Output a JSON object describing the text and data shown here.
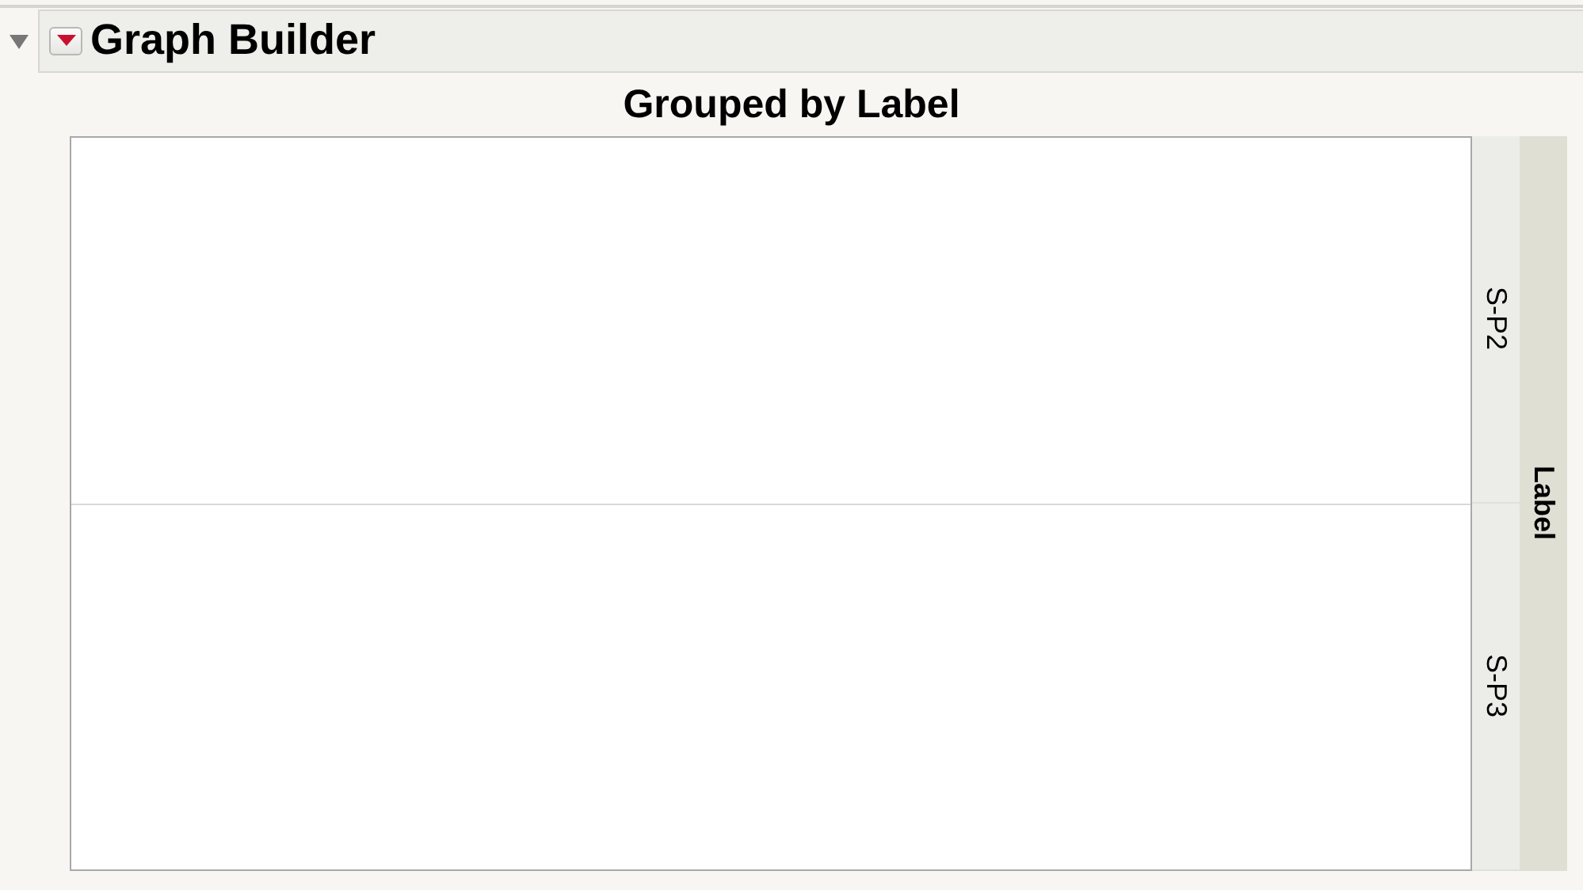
{
  "outline": {
    "expanded": true,
    "title": "Graph Builder"
  },
  "graph": {
    "title": "Grouped by Label",
    "group_title": "Label",
    "panels": [
      {
        "label": "S-P2"
      },
      {
        "label": "S-P3"
      }
    ]
  }
}
